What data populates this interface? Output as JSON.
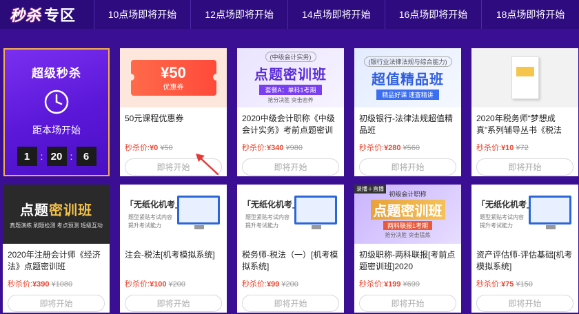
{
  "header": {
    "brand_part1": "秒杀",
    "brand_part2": "专区",
    "tabs": [
      "10点场即将开始",
      "12点场即将开始",
      "14点场即将开始",
      "16点场即将开始",
      "18点场即将开始"
    ]
  },
  "flash_sale": {
    "title": "超级秒杀",
    "subtitle": "距本场开始",
    "countdown": [
      "1",
      "20",
      "6"
    ],
    "sep": ":"
  },
  "price_label": "秒杀价:",
  "button_label": "即将开始",
  "products": [
    {
      "thumb": {
        "type": "coupon",
        "value": "¥50",
        "label": "优惠券"
      },
      "title": "50元课程优惠券",
      "price": "¥0",
      "original": "¥50"
    },
    {
      "thumb": {
        "type": "purple",
        "tag": "(中级会计实务)",
        "word": "点题密训班",
        "sub": "套餐A：单科1考期",
        "tiny": "抢分决胜 突击密养"
      },
      "title": "2020中级会计职称《中级会计实务》考前点题密训班",
      "price": "¥340",
      "original": "¥980"
    },
    {
      "thumb": {
        "type": "blue",
        "tag": "(银行业法律法规与综合能力)",
        "word": "超值精品班",
        "sub": "精品好课 速查精讲"
      },
      "title": "初级银行-法律法规超值精品班",
      "price": "¥280",
      "original": "¥560"
    },
    {
      "thumb": {
        "type": "book"
      },
      "title": "2020年税务师“梦想成真”系列辅导丛书《税法二…",
      "price": "¥10",
      "original": "¥72"
    },
    {
      "thumb": {
        "type": "dark",
        "word_a": "点题",
        "word_b": "密训班",
        "sub": "真题演练 刷题检测 考点预测 班级互动"
      },
      "title": "2020年注册会计师《经济法》点题密训班",
      "price": "¥390",
      "original": "¥1080"
    },
    {
      "thumb": {
        "type": "exam",
        "tag": "「无纸化机考」",
        "line1": "题型紧贴考试内容",
        "line2": "提升考试能力"
      },
      "title": "注会-税法[机考模拟系统]",
      "price": "¥100",
      "original": "¥200"
    },
    {
      "thumb": {
        "type": "exam",
        "tag": "「无纸化机考」",
        "line1": "题型紧贴考试内容",
        "line2": "提升考试能力"
      },
      "title": "税务师-税法（一）[机考模拟系统]",
      "price": "¥99",
      "original": "¥200"
    },
    {
      "thumb": {
        "type": "mixed",
        "badge": "录播＋直播",
        "top": "初级会计职称",
        "word": "点题密训班",
        "sub": "两科联报1考期",
        "tiny": "抢分决胜 突击猛炼"
      },
      "title": "初级职称-两科联报[考前点题密训班]2020",
      "price": "¥199",
      "original": "¥699"
    },
    {
      "thumb": {
        "type": "exam",
        "tag": "「无纸化机考」",
        "line1": "题型紧贴考试内容",
        "line2": "提升考试能力"
      },
      "title": "资产评估师-评估基础[机考模拟系统]",
      "price": "¥75",
      "original": "¥150"
    }
  ]
}
